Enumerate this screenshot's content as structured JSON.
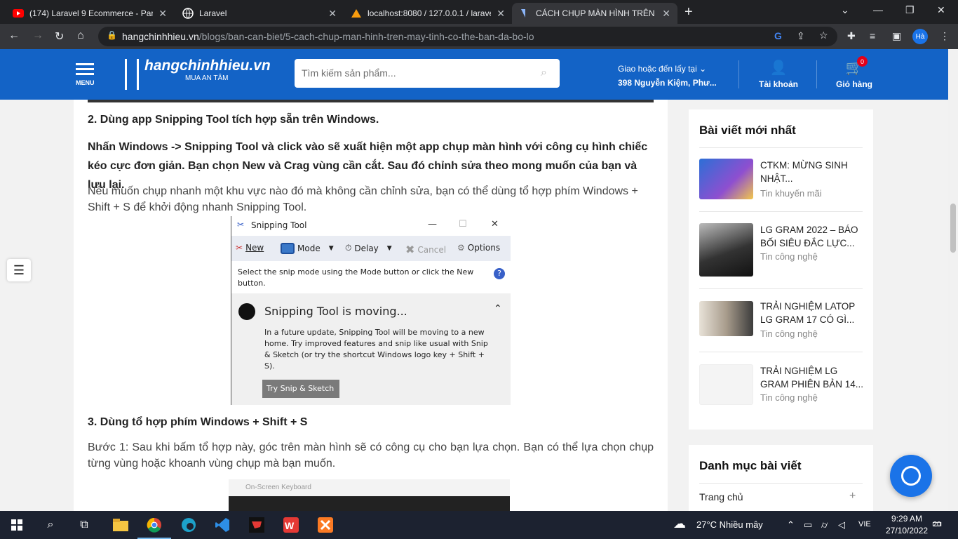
{
  "browser": {
    "tabs": [
      {
        "title": "(174) Laravel 9 Ecommerce - Part",
        "icon": "youtube-icon",
        "active": false
      },
      {
        "title": "Laravel",
        "icon": "globe-icon",
        "active": false
      },
      {
        "title": "localhost:8080 / 127.0.0.1 / larave",
        "icon": "phpmyadmin-icon",
        "active": false
      },
      {
        "title": "CÁCH CHỤP MÀN HÌNH TRÊN M",
        "icon": "page-icon",
        "active": true
      }
    ],
    "url_host": "hangchinhhieu.vn",
    "url_path": "/blogs/ban-can-biet/5-cach-chup-man-hinh-tren-may-tinh-co-the-ban-da-bo-lo",
    "profile_initials": "Hà"
  },
  "site": {
    "menu_label": "MENU",
    "logo_name": "hangchinhhieu.vn",
    "logo_tagline": "MUA AN TÂM",
    "search_placeholder": "Tìm kiếm sản phẩm...",
    "delivery_label": "Giao hoặc đến lấy tại",
    "delivery_address": "398 Nguyễn Kiệm, Phư...",
    "account_label": "Tài khoản",
    "cart_label": "Giỏ hàng",
    "cart_count": "0"
  },
  "article": {
    "h_snipping": "2. Dùng app Snipping Tool tích hợp sẵn trên Windows.",
    "bold_para": "Nhấn Windows -> Snipping Tool và click vào sẽ xuất hiện một app chụp màn hình với công cụ hình chiếc kéo cực đơn giản. Bạn chọn New và Crag vùng cần cắt. Sau đó chỉnh sửa theo mong muốn của bạn và lưu lại.",
    "para_quick": "Nếu muốn chụp nhanh một khu vực nào đó mà không cần chỉnh sửa, bạn có thể dùng tổ hợp phím Windows + Shift + S để khởi động nhanh Snipping Tool.",
    "h_shortcut": "3. Dùng tổ hợp phím Windows + Shift + S",
    "para_step1": "Bước 1: Sau khi bấm tổ hợp này, góc trên màn hình sẽ có công cụ cho bạn lựa chọn. Bạn có thể lựa chọn chụp từng vùng hoặc khoanh vùng chụp mà bạn muốn.",
    "osk_title": "On-Screen Keyboard"
  },
  "snipping_tool": {
    "title": "Snipping Tool",
    "new": "New",
    "mode": "Mode",
    "delay": "Delay",
    "cancel": "Cancel",
    "options": "Options",
    "message": "Select the snip mode using the Mode button or click the New button.",
    "moving_title": "Snipping Tool is moving...",
    "moving_body": "In a future update, Snipping Tool will be moving to a new home. Try improved features and snip like usual with Snip & Sketch (or try the shortcut Windows logo key + Shift + S).",
    "try_button": "Try Snip & Sketch"
  },
  "sidebar": {
    "recent_title": "Bài viết mới nhất",
    "posts": [
      {
        "title": "CTKM: MỪNG SINH NHẬT...",
        "category": "Tin khuyến mãi",
        "thumb": "#3a7bd5"
      },
      {
        "title": "LG GRAM 2022 – BÁO BỐI SIÊU ĐẮC LỰC...",
        "category": "Tin công nghệ",
        "thumb": "#555"
      },
      {
        "title": "TRẢI NGHIỆM LATOP LG GRAM 17 CÓ GÌ...",
        "category": "Tin công nghệ",
        "thumb": "#c9c2b8"
      },
      {
        "title": "TRẢI NGHIỆM LG GRAM PHIÊN BẢN 14...",
        "category": "Tin công nghệ",
        "thumb": "#eeeeee"
      }
    ],
    "categories_title": "Danh mục bài viết",
    "category_item": "Trang chủ"
  },
  "taskbar": {
    "weather": "27°C  Nhiều mây",
    "lang": "VIE",
    "time": "9:29 AM",
    "date": "27/10/2022",
    "notifications": "20"
  },
  "colors": {
    "brand": "#1363c6",
    "cart_badge": "#e30019",
    "chat": "#1a73e8"
  }
}
